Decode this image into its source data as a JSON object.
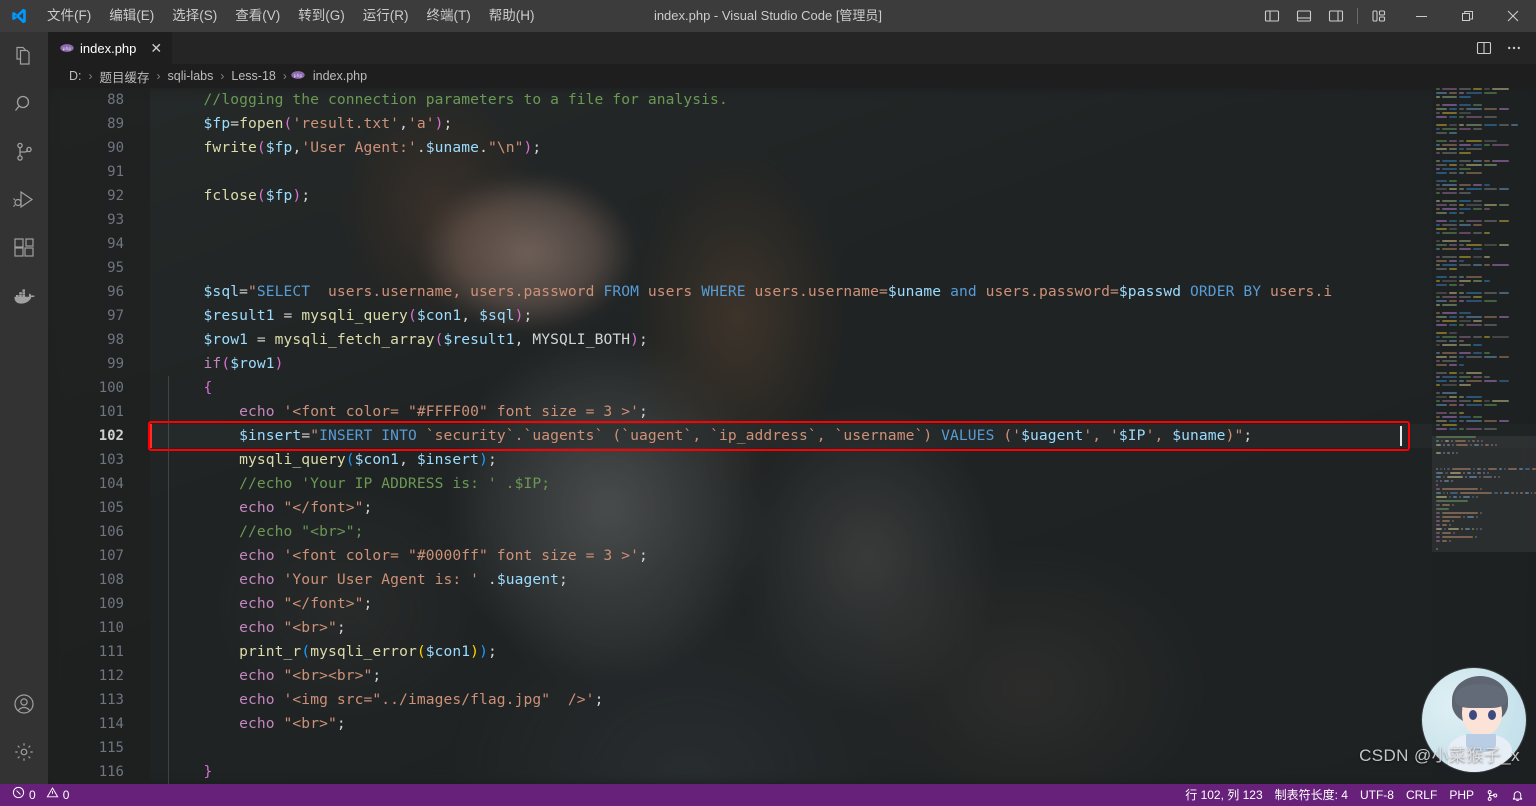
{
  "titlebar": {
    "logo_icon": "vscode-logo-icon",
    "window_title": "index.php - Visual Studio Code [管理员]",
    "menus": [
      {
        "label": "文件(F)",
        "name": "menu-file"
      },
      {
        "label": "编辑(E)",
        "name": "menu-edit"
      },
      {
        "label": "选择(S)",
        "name": "menu-selection"
      },
      {
        "label": "查看(V)",
        "name": "menu-view"
      },
      {
        "label": "转到(G)",
        "name": "menu-goto"
      },
      {
        "label": "运行(R)",
        "name": "menu-run"
      },
      {
        "label": "终端(T)",
        "name": "menu-terminal"
      },
      {
        "label": "帮助(H)",
        "name": "menu-help"
      }
    ],
    "layout_icons": [
      "toggle-primary-sidebar-icon",
      "toggle-panel-icon",
      "toggle-secondary-sidebar-icon",
      "customize-layout-icon"
    ],
    "window_buttons": [
      "minimize-icon",
      "restore-icon",
      "close-icon"
    ]
  },
  "activitybar": {
    "items": [
      {
        "name": "explorer-icon",
        "label": "资源管理器"
      },
      {
        "name": "search-icon",
        "label": "搜索"
      },
      {
        "name": "source-control-icon",
        "label": "源代码管理"
      },
      {
        "name": "run-debug-icon",
        "label": "运行和调试"
      },
      {
        "name": "extensions-icon",
        "label": "扩展"
      },
      {
        "name": "docker-icon",
        "label": "Docker"
      }
    ],
    "bottom_items": [
      {
        "name": "accounts-icon",
        "label": "账户"
      },
      {
        "name": "settings-gear-icon",
        "label": "管理"
      }
    ]
  },
  "tabs": {
    "open": [
      {
        "label": "index.php",
        "icon": "php-file-icon",
        "close_glyph": "✕",
        "active": true
      }
    ],
    "actions": [
      "split-editor-icon",
      "more-actions-icon"
    ]
  },
  "breadcrumb": {
    "separator": "›",
    "items": [
      "D:",
      "题目缓存",
      "sqli-labs",
      "Less-18",
      "index.php"
    ],
    "file_icon": "php-file-icon"
  },
  "editor": {
    "first_line_number": 88,
    "active_line": 102,
    "lines": [
      {
        "n": 88,
        "tokens": [
          {
            "t": "plain",
            "v": "    "
          },
          {
            "t": "com",
            "v": "//logging the connection parameters to a file for analysis."
          }
        ]
      },
      {
        "n": 89,
        "tokens": [
          {
            "t": "plain",
            "v": "    "
          },
          {
            "t": "var",
            "v": "$fp"
          },
          {
            "t": "plain",
            "v": "="
          },
          {
            "t": "fn",
            "v": "fopen"
          },
          {
            "t": "paren",
            "v": "("
          },
          {
            "t": "str",
            "v": "'result.txt'"
          },
          {
            "t": "punc",
            "v": ","
          },
          {
            "t": "str",
            "v": "'a'"
          },
          {
            "t": "paren",
            "v": ")"
          },
          {
            "t": "punc",
            "v": ";"
          }
        ]
      },
      {
        "n": 90,
        "tokens": [
          {
            "t": "plain",
            "v": "    "
          },
          {
            "t": "fn",
            "v": "fwrite"
          },
          {
            "t": "paren",
            "v": "("
          },
          {
            "t": "var",
            "v": "$fp"
          },
          {
            "t": "punc",
            "v": ","
          },
          {
            "t": "str",
            "v": "'User Agent:'"
          },
          {
            "t": "punc",
            "v": "."
          },
          {
            "t": "var",
            "v": "$uname"
          },
          {
            "t": "punc",
            "v": "."
          },
          {
            "t": "str",
            "v": "\"\\n\""
          },
          {
            "t": "paren",
            "v": ")"
          },
          {
            "t": "punc",
            "v": ";"
          }
        ]
      },
      {
        "n": 91,
        "tokens": []
      },
      {
        "n": 92,
        "tokens": [
          {
            "t": "plain",
            "v": "    "
          },
          {
            "t": "fn",
            "v": "fclose"
          },
          {
            "t": "paren",
            "v": "("
          },
          {
            "t": "var",
            "v": "$fp"
          },
          {
            "t": "paren",
            "v": ")"
          },
          {
            "t": "punc",
            "v": ";"
          }
        ]
      },
      {
        "n": 93,
        "tokens": []
      },
      {
        "n": 94,
        "tokens": []
      },
      {
        "n": 95,
        "tokens": []
      },
      {
        "n": 96,
        "tokens": [
          {
            "t": "plain",
            "v": "    "
          },
          {
            "t": "var",
            "v": "$sql"
          },
          {
            "t": "plain",
            "v": "="
          },
          {
            "t": "str",
            "v": "\""
          },
          {
            "t": "sqlkw",
            "v": "SELECT"
          },
          {
            "t": "str",
            "v": "  users.username, users.password "
          },
          {
            "t": "sqlkw",
            "v": "FROM"
          },
          {
            "t": "str",
            "v": " users "
          },
          {
            "t": "sqlkw",
            "v": "WHERE"
          },
          {
            "t": "str",
            "v": " users.username="
          },
          {
            "t": "var",
            "v": "$uname"
          },
          {
            "t": "str",
            "v": " "
          },
          {
            "t": "sqlkw",
            "v": "and"
          },
          {
            "t": "str",
            "v": " users.password="
          },
          {
            "t": "var",
            "v": "$passwd"
          },
          {
            "t": "str",
            "v": " "
          },
          {
            "t": "sqlkw",
            "v": "ORDER BY"
          },
          {
            "t": "str",
            "v": " users.i"
          }
        ]
      },
      {
        "n": 97,
        "tokens": [
          {
            "t": "plain",
            "v": "    "
          },
          {
            "t": "var",
            "v": "$result1"
          },
          {
            "t": "plain",
            "v": " = "
          },
          {
            "t": "fn",
            "v": "mysqli_query"
          },
          {
            "t": "paren",
            "v": "("
          },
          {
            "t": "var",
            "v": "$con1"
          },
          {
            "t": "punc",
            "v": ", "
          },
          {
            "t": "var",
            "v": "$sql"
          },
          {
            "t": "paren",
            "v": ")"
          },
          {
            "t": "punc",
            "v": ";"
          }
        ]
      },
      {
        "n": 98,
        "tokens": [
          {
            "t": "plain",
            "v": "    "
          },
          {
            "t": "var",
            "v": "$row1"
          },
          {
            "t": "plain",
            "v": " = "
          },
          {
            "t": "fn",
            "v": "mysqli_fetch_array"
          },
          {
            "t": "paren",
            "v": "("
          },
          {
            "t": "var",
            "v": "$result1"
          },
          {
            "t": "punc",
            "v": ", "
          },
          {
            "t": "const",
            "v": "MYSQLI_BOTH"
          },
          {
            "t": "paren",
            "v": ")"
          },
          {
            "t": "punc",
            "v": ";"
          }
        ]
      },
      {
        "n": 99,
        "tokens": [
          {
            "t": "plain",
            "v": "    "
          },
          {
            "t": "kw",
            "v": "if"
          },
          {
            "t": "paren",
            "v": "("
          },
          {
            "t": "var",
            "v": "$row1"
          },
          {
            "t": "paren",
            "v": ")"
          }
        ]
      },
      {
        "n": 100,
        "tokens": [
          {
            "t": "plain",
            "v": "    "
          },
          {
            "t": "paren",
            "v": "{"
          }
        ]
      },
      {
        "n": 101,
        "tokens": [
          {
            "t": "plain",
            "v": "        "
          },
          {
            "t": "kw",
            "v": "echo"
          },
          {
            "t": "plain",
            "v": " "
          },
          {
            "t": "str",
            "v": "'<font color= \"#FFFF00\" font size = 3 >'"
          },
          {
            "t": "punc",
            "v": ";"
          }
        ]
      },
      {
        "n": 102,
        "tokens": [
          {
            "t": "plain",
            "v": "        "
          },
          {
            "t": "var",
            "v": "$insert"
          },
          {
            "t": "plain",
            "v": "="
          },
          {
            "t": "str",
            "v": "\""
          },
          {
            "t": "sqlkw",
            "v": "INSERT INTO"
          },
          {
            "t": "str",
            "v": " `security`.`uagents` (`uagent`, `ip_address`, `username`) "
          },
          {
            "t": "sqlkw",
            "v": "VALUES"
          },
          {
            "t": "str",
            "v": " ('"
          },
          {
            "t": "var",
            "v": "$uagent"
          },
          {
            "t": "str",
            "v": "', '"
          },
          {
            "t": "var",
            "v": "$IP"
          },
          {
            "t": "str",
            "v": "', "
          },
          {
            "t": "var",
            "v": "$uname"
          },
          {
            "t": "str",
            "v": ")\""
          },
          {
            "t": "punc",
            "v": ";"
          }
        ]
      },
      {
        "n": 103,
        "tokens": [
          {
            "t": "plain",
            "v": "        "
          },
          {
            "t": "fn",
            "v": "mysqli_query"
          },
          {
            "t": "paren2",
            "v": "("
          },
          {
            "t": "var",
            "v": "$con1"
          },
          {
            "t": "punc",
            "v": ", "
          },
          {
            "t": "var",
            "v": "$insert"
          },
          {
            "t": "paren2",
            "v": ")"
          },
          {
            "t": "punc",
            "v": ";"
          }
        ]
      },
      {
        "n": 104,
        "tokens": [
          {
            "t": "plain",
            "v": "        "
          },
          {
            "t": "com",
            "v": "//echo 'Your IP ADDRESS is: ' .$IP;"
          }
        ]
      },
      {
        "n": 105,
        "tokens": [
          {
            "t": "plain",
            "v": "        "
          },
          {
            "t": "kw",
            "v": "echo"
          },
          {
            "t": "plain",
            "v": " "
          },
          {
            "t": "str",
            "v": "\"</font>\""
          },
          {
            "t": "punc",
            "v": ";"
          }
        ]
      },
      {
        "n": 106,
        "tokens": [
          {
            "t": "plain",
            "v": "        "
          },
          {
            "t": "com",
            "v": "//echo \"<br>\";"
          }
        ]
      },
      {
        "n": 107,
        "tokens": [
          {
            "t": "plain",
            "v": "        "
          },
          {
            "t": "kw",
            "v": "echo"
          },
          {
            "t": "plain",
            "v": " "
          },
          {
            "t": "str",
            "v": "'<font color= \"#0000ff\" font size = 3 >'"
          },
          {
            "t": "punc",
            "v": ";"
          }
        ]
      },
      {
        "n": 108,
        "tokens": [
          {
            "t": "plain",
            "v": "        "
          },
          {
            "t": "kw",
            "v": "echo"
          },
          {
            "t": "plain",
            "v": " "
          },
          {
            "t": "str",
            "v": "'Your User Agent is: '"
          },
          {
            "t": "punc",
            "v": " ."
          },
          {
            "t": "var",
            "v": "$uagent"
          },
          {
            "t": "punc",
            "v": ";"
          }
        ]
      },
      {
        "n": 109,
        "tokens": [
          {
            "t": "plain",
            "v": "        "
          },
          {
            "t": "kw",
            "v": "echo"
          },
          {
            "t": "plain",
            "v": " "
          },
          {
            "t": "str",
            "v": "\"</font>\""
          },
          {
            "t": "punc",
            "v": ";"
          }
        ]
      },
      {
        "n": 110,
        "tokens": [
          {
            "t": "plain",
            "v": "        "
          },
          {
            "t": "kw",
            "v": "echo"
          },
          {
            "t": "plain",
            "v": " "
          },
          {
            "t": "str",
            "v": "\"<br>\""
          },
          {
            "t": "punc",
            "v": ";"
          }
        ]
      },
      {
        "n": 111,
        "tokens": [
          {
            "t": "plain",
            "v": "        "
          },
          {
            "t": "fn",
            "v": "print_r"
          },
          {
            "t": "paren2",
            "v": "("
          },
          {
            "t": "fn",
            "v": "mysqli_error"
          },
          {
            "t": "paren3",
            "v": "("
          },
          {
            "t": "var",
            "v": "$con1"
          },
          {
            "t": "paren3",
            "v": ")"
          },
          {
            "t": "paren2",
            "v": ")"
          },
          {
            "t": "punc",
            "v": ";"
          }
        ]
      },
      {
        "n": 112,
        "tokens": [
          {
            "t": "plain",
            "v": "        "
          },
          {
            "t": "kw",
            "v": "echo"
          },
          {
            "t": "plain",
            "v": " "
          },
          {
            "t": "str",
            "v": "\"<br><br>\""
          },
          {
            "t": "punc",
            "v": ";"
          }
        ]
      },
      {
        "n": 113,
        "tokens": [
          {
            "t": "plain",
            "v": "        "
          },
          {
            "t": "kw",
            "v": "echo"
          },
          {
            "t": "plain",
            "v": " "
          },
          {
            "t": "str",
            "v": "'<img src=\"../images/flag.jpg\"  />'"
          },
          {
            "t": "punc",
            "v": ";"
          }
        ]
      },
      {
        "n": 114,
        "tokens": [
          {
            "t": "plain",
            "v": "        "
          },
          {
            "t": "kw",
            "v": "echo"
          },
          {
            "t": "plain",
            "v": " "
          },
          {
            "t": "str",
            "v": "\"<br>\""
          },
          {
            "t": "punc",
            "v": ";"
          }
        ]
      },
      {
        "n": 115,
        "tokens": []
      },
      {
        "n": 116,
        "tokens": [
          {
            "t": "plain",
            "v": "    "
          },
          {
            "t": "paren",
            "v": "}"
          }
        ]
      }
    ],
    "highlight_box": {
      "line": 102,
      "color": "#ff0000"
    }
  },
  "statusbar": {
    "left": [
      {
        "name": "remote-indicator",
        "label": ""
      },
      {
        "name": "problems-errors",
        "icon": "error-circle-icon",
        "label": "0"
      },
      {
        "name": "problems-warnings",
        "icon": "warning-triangle-icon",
        "label": "0"
      }
    ],
    "right": [
      {
        "name": "editor-position",
        "label": "行 102, 列 123"
      },
      {
        "name": "editor-indentation",
        "label": "制表符长度: 4"
      },
      {
        "name": "editor-encoding",
        "label": "UTF-8"
      },
      {
        "name": "editor-eol",
        "label": "CRLF"
      },
      {
        "name": "editor-language",
        "label": "PHP"
      },
      {
        "name": "port-forwarding",
        "label": "⑂"
      },
      {
        "name": "notifications-bell",
        "label": "🔔"
      }
    ]
  },
  "watermark": {
    "text": "CSDN @小菜猴子_x",
    "avatar_name": "csdn-author-avatar"
  }
}
